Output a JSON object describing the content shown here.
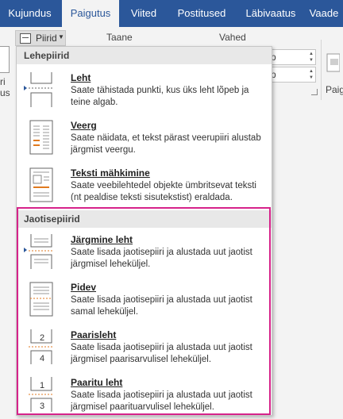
{
  "tabs": [
    {
      "label": "Kujundus"
    },
    {
      "label": "Paigutus"
    },
    {
      "label": "Viited"
    },
    {
      "label": "Postitused"
    },
    {
      "label": "Läbivaatus"
    },
    {
      "label": "Vaade"
    }
  ],
  "ribbon": {
    "piirid_label": "Piirid",
    "taane_label": "Taane",
    "vahed_label": "Vahed",
    "spin1_value": "p",
    "spin2_value": "p",
    "left_partial_label": "ri",
    "left_partial_label2": "us",
    "right_partial_label": "Paig"
  },
  "menu": {
    "section1": "Lehepiirid",
    "section2": "Jaotisepiirid",
    "items": [
      {
        "title": "Leht",
        "desc": "Saate tähistada punkti, kus üks leht lõpeb ja teine algab."
      },
      {
        "title": "Veerg",
        "desc": "Saate näidata, et tekst pärast veerupiiri alustab järgmist veergu."
      },
      {
        "title": "Teksti mähkimine",
        "desc": "Saate veebilehtedel objekte ümbritsevat teksti (nt pealdise teksti sisutekstist) eraldada."
      },
      {
        "title": "Järgmine leht",
        "desc": "Saate lisada jaotisepiiri ja alustada uut jaotist järgmisel leheküljel."
      },
      {
        "title": "Pidev",
        "desc": "Saate lisada jaotisepiiri ja alustada uut jaotist samal leheküljel."
      },
      {
        "title": "Paarisleht",
        "desc": "Saate lisada jaotisepiiri ja alustada uut jaotist järgmisel paarisarvulisel leheküljel."
      },
      {
        "title": "Paaritu leht",
        "desc": "Saate lisada jaotisepiiri ja alustada uut jaotist järgmisel paarituarvulisel leheküljel."
      }
    ],
    "icon_numbers": {
      "even_a": "2",
      "even_b": "4",
      "odd_a": "1",
      "odd_b": "3"
    }
  },
  "colors": {
    "ribbon_blue": "#2b579a",
    "highlight": "#d6238a",
    "accent_orange": "#e07a1f"
  }
}
